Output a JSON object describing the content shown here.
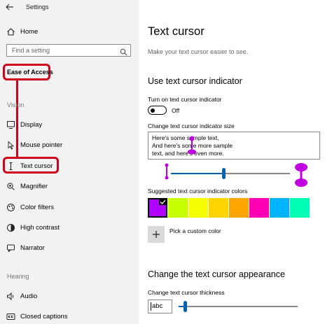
{
  "window": {
    "title": "Settings"
  },
  "sidebar": {
    "home": "Home",
    "search_placeholder": "Find a setting",
    "category": "Ease of Access",
    "sections": {
      "vision": "Vision",
      "hearing": "Hearing"
    },
    "items": [
      {
        "label": "Display",
        "icon": "display-icon"
      },
      {
        "label": "Mouse pointer",
        "icon": "mouse-pointer-icon"
      },
      {
        "label": "Text cursor",
        "icon": "text-cursor-icon",
        "selected": true
      },
      {
        "label": "Magnifier",
        "icon": "magnifier-icon"
      },
      {
        "label": "Color filters",
        "icon": "color-filters-icon"
      },
      {
        "label": "High contrast",
        "icon": "high-contrast-icon"
      },
      {
        "label": "Narrator",
        "icon": "narrator-icon"
      },
      {
        "label": "Audio",
        "icon": "audio-icon"
      },
      {
        "label": "Closed captions",
        "icon": "closed-captions-icon"
      }
    ]
  },
  "main": {
    "title": "Text cursor",
    "subtitle": "Make your text cursor easier to see.",
    "indicator": {
      "heading": "Use text cursor indicator",
      "toggle_label": "Turn on text cursor indicator",
      "toggle_state": "Off",
      "size_label": "Change text cursor indicator size",
      "sample_lines": [
        "Here's some sample text,",
        "And here's some more sample",
        "text, and here's even more."
      ],
      "size_slider_value": 0.44,
      "colors_label": "Suggested text cursor indicator colors",
      "colors": [
        "#b000ff",
        "#c6ff00",
        "#f5ff00",
        "#ffd400",
        "#ffa500",
        "#ff00b4",
        "#00b4ff",
        "#00ffb4"
      ],
      "selected_color_index": 0,
      "custom_color": "Pick a custom color"
    },
    "appearance": {
      "heading": "Change the text cursor appearance",
      "thickness_label": "Change text cursor thickness",
      "preview_text": "abc",
      "thickness_value": 0.05
    }
  },
  "colors": {
    "accent": "#0063b1",
    "highlight": "#d0021b",
    "indicator": "#c000e0"
  }
}
